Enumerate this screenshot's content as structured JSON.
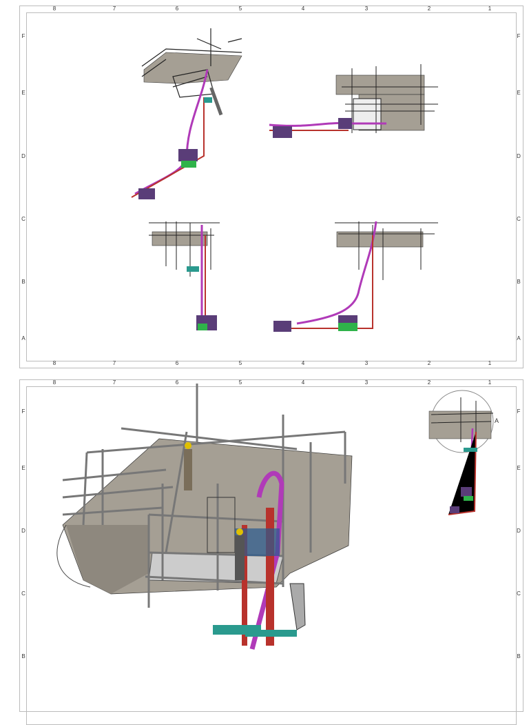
{
  "sheets": [
    {
      "columns": [
        "8",
        "7",
        "6",
        "5",
        "4",
        "3",
        "2",
        "1"
      ],
      "rows": [
        "F",
        "E",
        "D",
        "C",
        "B",
        "A"
      ],
      "views": [
        "isometric-view",
        "top-view",
        "front-view",
        "side-view"
      ]
    },
    {
      "columns": [
        "8",
        "7",
        "6",
        "5",
        "4",
        "3",
        "2",
        "1"
      ],
      "rows": [
        "F",
        "E",
        "D",
        "C",
        "B"
      ],
      "views": [
        "detail-view-a",
        "isometric-overview"
      ],
      "detail_label": "A"
    }
  ],
  "colors": {
    "concrete": "#a59f94",
    "pipe_magenta": "#b03ab8",
    "pipe_red": "#b8322c",
    "box_purple": "#5a3d78",
    "box_green": "#2fb34a",
    "teal": "#2a9a8e",
    "steel": "#666"
  }
}
